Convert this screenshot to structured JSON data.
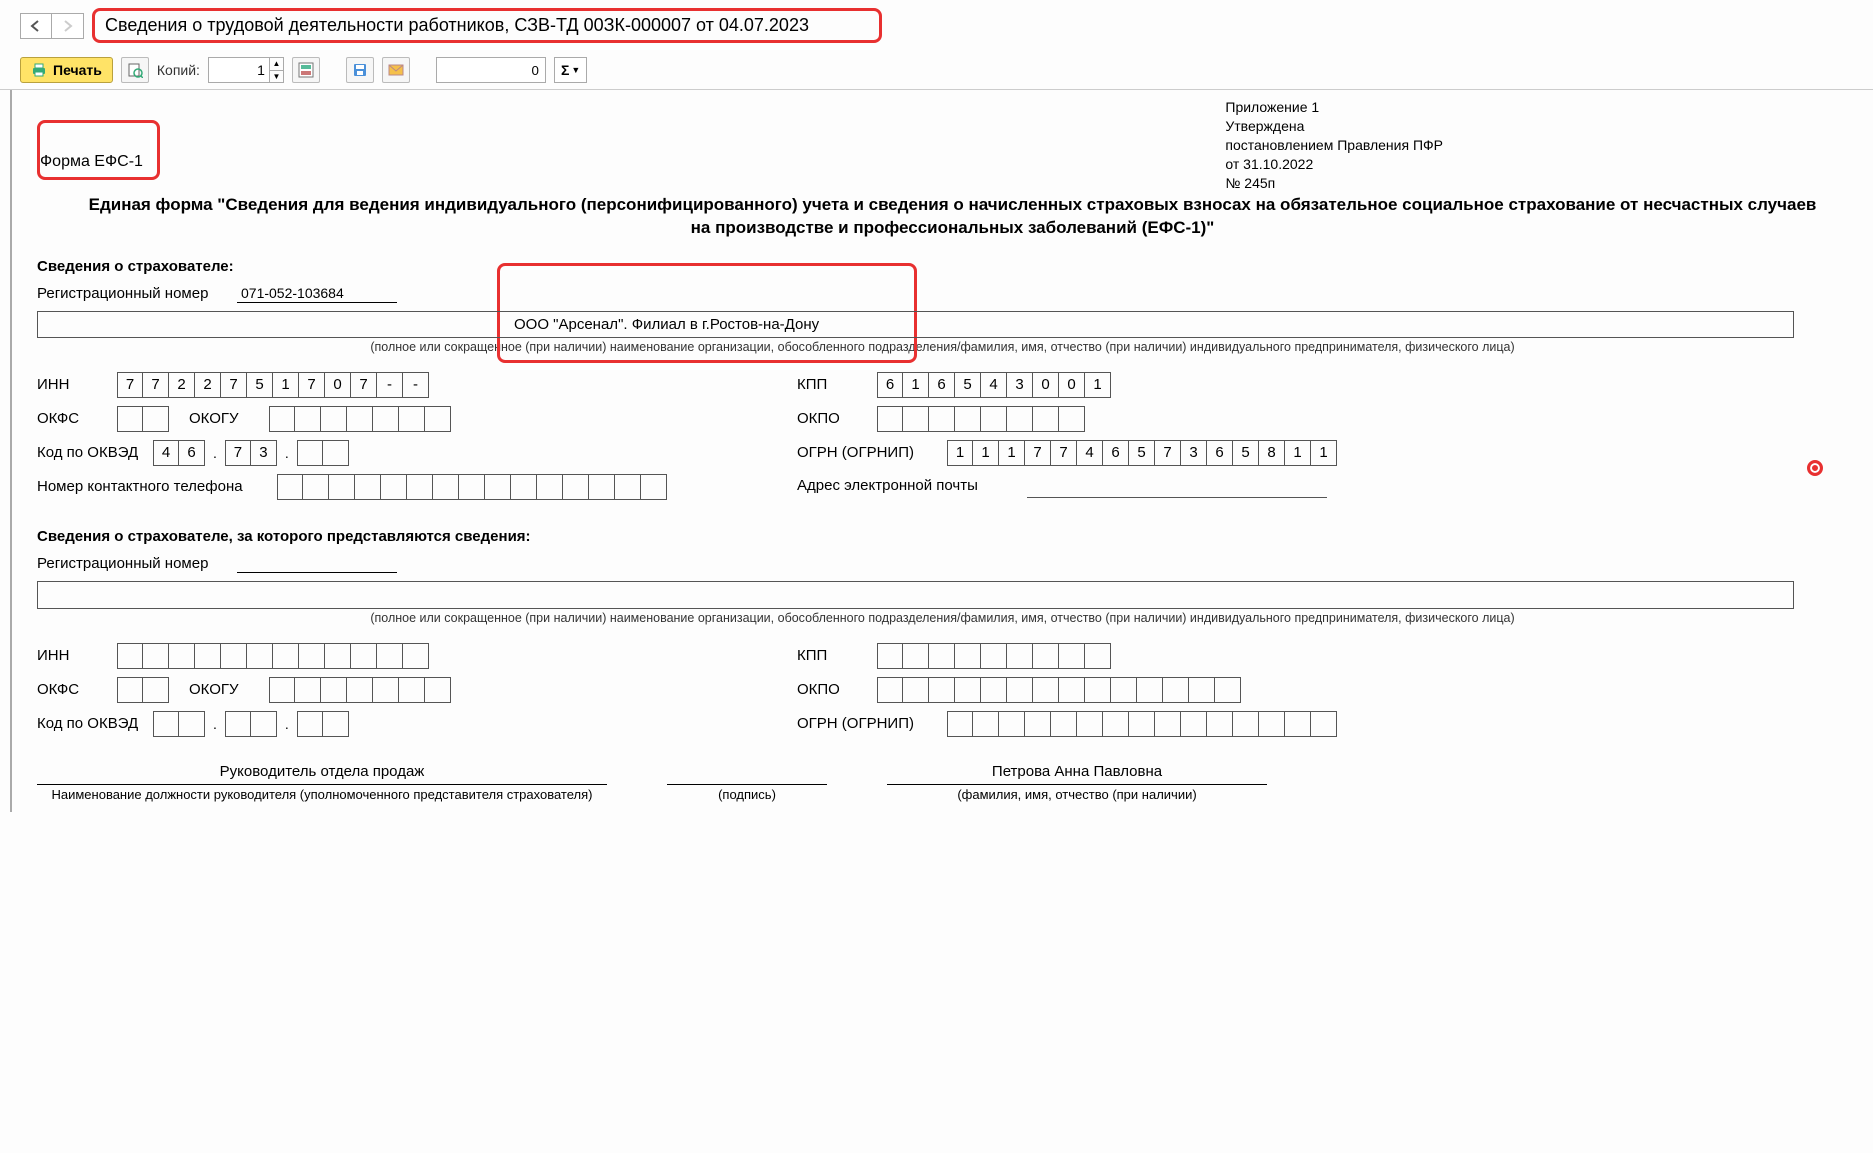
{
  "header": {
    "title": "Сведения о трудовой деятельности работников, СЗВ-ТД 00ЗК-000007 от 04.07.2023"
  },
  "toolbar": {
    "print_label": "Печать",
    "copies_label": "Копий:",
    "copies_value": "1",
    "numeric_value": "0",
    "sigma": "Σ"
  },
  "annex": {
    "line1": "Приложение 1",
    "line2": "Утверждена",
    "line3": "постановлением Правления ПФР",
    "line4": "от 31.10.2022",
    "line5": "№ 245п"
  },
  "form_code": "Форма ЕФС-1",
  "main_title": "Единая форма \"Сведения для ведения индивидуального (персонифицированного) учета и сведения о начисленных страховых взносах на обязательное социальное страхование от несчастных случаев на производстве и профессиональных заболеваний (ЕФС-1)\"",
  "section1": {
    "title": "Сведения о страхователе:",
    "reg_label": "Регистрационный номер",
    "reg_value": "071-052-103684",
    "org_name": "ООО \"Арсенал\". Филиал в г.Ростов-на-Дону",
    "org_hint": "(полное или сокращенное (при наличии) наименование организации, обособленного подразделения/фамилия, имя, отчество (при наличии) индивидуального предпринимателя, физического лица)",
    "inn_label": "ИНН",
    "inn": [
      "7",
      "7",
      "2",
      "2",
      "7",
      "5",
      "1",
      "7",
      "0",
      "7",
      "-",
      "-"
    ],
    "kpp_label": "КПП",
    "kpp": [
      "6",
      "1",
      "6",
      "5",
      "4",
      "3",
      "0",
      "0",
      "1"
    ],
    "okfs_label": "ОКФС",
    "okogu_label": "ОКОГУ",
    "okpo_label": "ОКПО",
    "okved_label": "Код по ОКВЭД",
    "okved_g1": [
      "4",
      "6"
    ],
    "okved_g2": [
      "7",
      "3"
    ],
    "okved_g3": [
      "",
      ""
    ],
    "ogrn_label": "ОГРН (ОГРНИП)",
    "ogrn": [
      "1",
      "1",
      "1",
      "7",
      "7",
      "4",
      "6",
      "5",
      "7",
      "3",
      "6",
      "5",
      "8",
      "1",
      "1"
    ],
    "phone_label": "Номер контактного телефона",
    "email_label": "Адрес электронной почты"
  },
  "section2": {
    "title": "Сведения о страхователе, за которого представляются сведения:",
    "reg_label": "Регистрационный номер",
    "org_hint": "(полное или сокращенное (при наличии) наименование организации, обособленного подразделения/фамилия, имя, отчество (при наличии) индивидуального предпринимателя, физического лица)",
    "inn_label": "ИНН",
    "kpp_label": "КПП",
    "okfs_label": "ОКФС",
    "okogu_label": "ОКОГУ",
    "okpo_label": "ОКПО",
    "okved_label": "Код по ОКВЭД",
    "ogrn_label": "ОГРН (ОГРНИП)"
  },
  "signatures": {
    "position": "Руководитель отдела продаж",
    "position_hint": "Наименование должности руководителя (уполномоченного представителя страхователя)",
    "sign_hint": "(подпись)",
    "fio": "Петрова Анна Павловна",
    "fio_hint": "(фамилия, имя, отчество (при наличии)"
  }
}
